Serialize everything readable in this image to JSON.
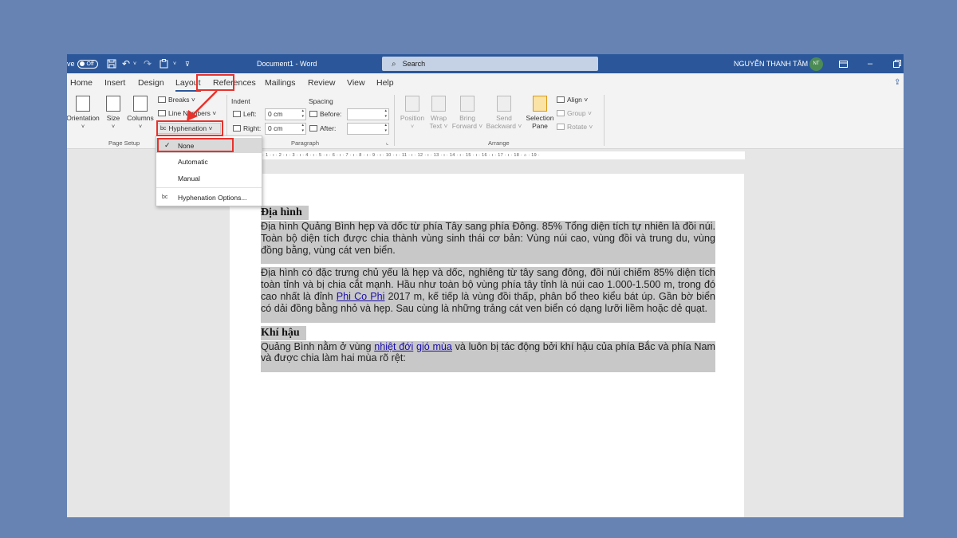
{
  "titlebar": {
    "autosave_prefix": "ve",
    "autosave_state": "Off",
    "document_title": "Document1  -  Word",
    "search_placeholder": "Search",
    "user_name": "NGUYỄN THANH TÂM",
    "user_initials": "NT"
  },
  "tabs": [
    "Home",
    "Insert",
    "Design",
    "Layout",
    "References",
    "Mailings",
    "Review",
    "View",
    "Help"
  ],
  "ribbon": {
    "page_setup": {
      "orientation": "Orientation",
      "size": "Size",
      "columns": "Columns",
      "breaks": "Breaks ˅",
      "line_numbers": "Line Numbers ˅",
      "hyphenation": "Hyphenation ˅",
      "group_label": "Page Setup"
    },
    "paragraph": {
      "indent_label": "Indent",
      "spacing_label": "Spacing",
      "left_label": "Left:",
      "left_value": "0 cm",
      "right_label": "Right:",
      "right_value": "0 cm",
      "before_label": "Before:",
      "after_label": "After:",
      "group_label": "Paragraph"
    },
    "arrange": {
      "position": "Position",
      "wrap_text": "Wrap Text ˅",
      "bring_forward": "Bring Forward ˅",
      "send_backward": "Send Backward ˅",
      "selection_pane": "Selection Pane",
      "align": "Align ˅",
      "group": "Group ˅",
      "rotate": "Rotate ˅",
      "group_label": "Arrange"
    }
  },
  "hyphenation_menu": {
    "items": [
      {
        "label": "None",
        "checked": true
      },
      {
        "label": "Automatic",
        "checked": false
      },
      {
        "label": "Manual",
        "checked": false
      }
    ],
    "options": "Hyphenation Options..."
  },
  "ruler": "· 1 · ı · 2 · ı · 3 · ı · 4 · ı · 5 · ı · 6 · ı · 7 · ı · 8 · ı · 9 · ı · 10 · ı · 11 · ı · 12 · ı · 13 · ı · 14 · ı · 15 · ı · 16 · ı · 17 · ı · 18 · ⌂ · 19 ·",
  "document": {
    "heading1": "Địa hình",
    "para1": "Địa hình Quảng Bình hẹp và dốc từ phía Tây sang phía Đông. 85% Tổng diện tích tự nhiên là đồi núi. Toàn bộ diện tích được chia thành vùng sinh thái cơ bản: Vùng núi cao, vùng đồi và trung du, vùng đồng bằng, vùng cát ven biển.",
    "para2_a": "Địa hình có đặc trưng chủ yếu là hẹp và dốc, nghiêng từ tây sang đông, đồi núi chiếm 85% diện tích toàn tỉnh và bị chia cắt mạnh. Hầu như toàn bộ vùng phía tây tỉnh là núi cao 1.000-1.500 m, trong đó cao nhất là đỉnh ",
    "para2_link": "Phi Co Phi",
    "para2_b": " 2017 m, kế tiếp là vùng đồi thấp, phân bổ theo kiểu bát úp. Gần bờ biển có dải đồng bằng nhỏ và hẹp. Sau cùng là những trảng cát ven biển có dạng lưỡi liềm hoặc dẻ quạt.",
    "heading2": "Khí hậu",
    "para3_a": "Quảng Bình nằm ở vùng ",
    "para3_link1": "nhiệt đới",
    "para3_link2": "gió mùa",
    "para3_b": " và luôn bị tác động bởi khí hậu của phía Bắc và phía Nam và được chia làm hai mùa rõ rệt:"
  }
}
